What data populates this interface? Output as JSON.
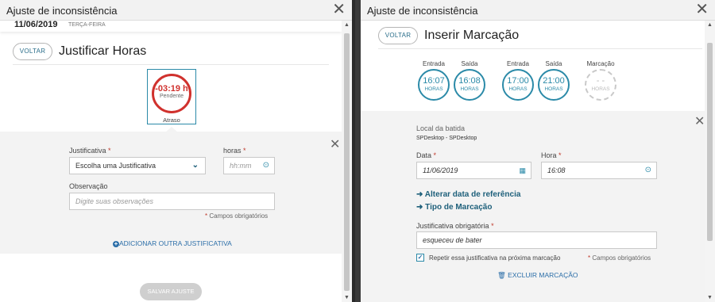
{
  "left": {
    "title": "Ajuste de inconsistência",
    "close": "✕",
    "date": "11/06/2019",
    "weekday": "TERÇA-FEIRA",
    "back_label": "VOLTAR",
    "heading": "Justificar Horas",
    "badge_value": "-03:19 h",
    "badge_status": "Pendente",
    "badge_caption": "Atraso",
    "justificativa_label": "Justificativa",
    "justificativa_value": "Escolha uma Justificativa",
    "horas_label": "horas",
    "horas_placeholder": "hh:mm",
    "observacao_label": "Observação",
    "observacao_placeholder": "Digite suas observações",
    "required_note": "Campos obrigatórios",
    "add_label": "ADICIONAR OUTRA JUSTIFICATIVA",
    "save_label": "SALVAR AJUSTE",
    "required_star": "*"
  },
  "right": {
    "title": "Ajuste de inconsistência",
    "close": "✕",
    "back_label": "VOLTAR",
    "heading": "Inserir Marcação",
    "marks": [
      {
        "label": "Entrada",
        "value": "16:07",
        "unit": "HORAS"
      },
      {
        "label": "Saída",
        "value": "16:08",
        "unit": "HORAS"
      },
      {
        "label": "Entrada",
        "value": "17:00",
        "unit": "HORAS"
      },
      {
        "label": "Saída",
        "value": "21:00",
        "unit": "HORAS"
      },
      {
        "label": "Marcação",
        "value": "- -",
        "unit": "HORAS"
      }
    ],
    "local_label": "Local da batida",
    "local_value": "SPDesktop - SPDesktop",
    "data_label": "Data",
    "data_value": "11/06/2019",
    "hora_label": "Hora",
    "hora_value": "16:08",
    "alterar_label": "Alterar data de referência",
    "tipo_label": "Tipo de Marcação",
    "just_label": "Justificativa obrigatória",
    "just_value": "esqueceu de bater",
    "repeat_label": "Repetir essa justificativa na próxima marcação",
    "required_note": "Campos obrigatórios",
    "excluir_label": "EXCLUIR MARCAÇÃO",
    "required_star": "*"
  },
  "colors": {
    "accent": "#2b8aa8",
    "danger": "#d0312d",
    "link": "#1d5f7a"
  }
}
